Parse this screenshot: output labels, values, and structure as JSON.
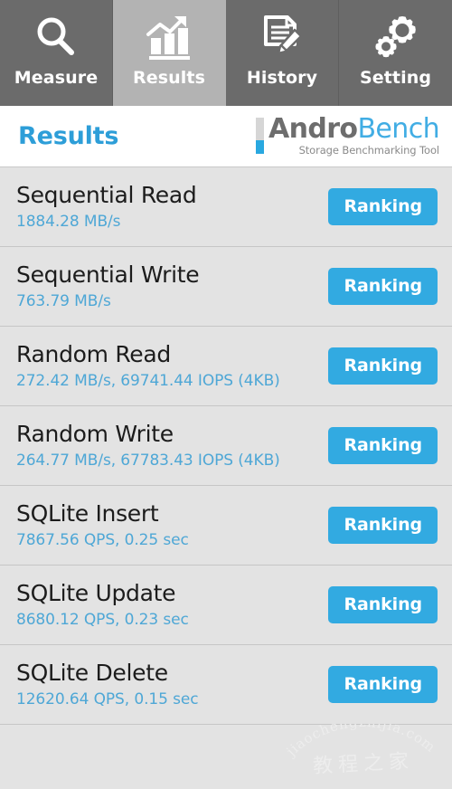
{
  "navbar": {
    "tabs": [
      {
        "label": "Measure",
        "icon": "magnifier-icon",
        "active": false
      },
      {
        "label": "Results",
        "icon": "bar-chart-arrow-icon",
        "active": true
      },
      {
        "label": "History",
        "icon": "document-pencil-icon",
        "active": false
      },
      {
        "label": "Setting",
        "icon": "gears-icon",
        "active": false
      }
    ]
  },
  "header": {
    "title": "Results",
    "logo": {
      "name_primary": "Andro",
      "name_secondary": "Bench",
      "tagline": "Storage Benchmarking Tool"
    }
  },
  "results": {
    "rows": [
      {
        "title": "Sequential Read",
        "value": "1884.28 MB/s",
        "button": "Ranking"
      },
      {
        "title": "Sequential Write",
        "value": "763.79 MB/s",
        "button": "Ranking"
      },
      {
        "title": "Random Read",
        "value": "272.42 MB/s, 69741.44 IOPS (4KB)",
        "button": "Ranking"
      },
      {
        "title": "Random Write",
        "value": "264.77 MB/s, 67783.43 IOPS (4KB)",
        "button": "Ranking"
      },
      {
        "title": "SQLite Insert",
        "value": "7867.56 QPS, 0.25 sec",
        "button": "Ranking"
      },
      {
        "title": "SQLite Update",
        "value": "8680.12 QPS, 0.23 sec",
        "button": "Ranking"
      },
      {
        "title": "SQLite Delete",
        "value": "12620.64 QPS, 0.15 sec",
        "button": "Ranking"
      }
    ]
  },
  "watermark": {
    "latin": "jiaochengzhijia.com",
    "cjk": "教程之家"
  },
  "colors": {
    "accent_blue": "#32aae1",
    "title_blue": "#2d9ed8",
    "value_blue": "#4ea7d6",
    "nav_background": "#6b6b6b",
    "nav_active_background": "#b3b3b3",
    "list_background": "#e3e3e3"
  }
}
